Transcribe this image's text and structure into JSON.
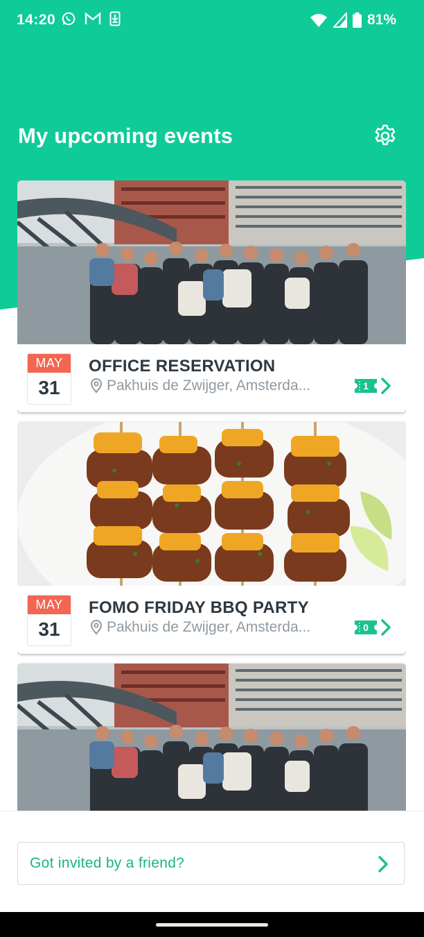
{
  "status_bar": {
    "time": "14:20",
    "battery_percent": "81%",
    "left_icons": [
      "whatsapp-icon",
      "gmail-icon",
      "download-icon"
    ],
    "right_icons": [
      "wifi-icon",
      "signal-icon",
      "battery-icon"
    ]
  },
  "header": {
    "title": "My upcoming events",
    "settings_icon": "gear-icon"
  },
  "events": [
    {
      "month": "MAY",
      "day": "31",
      "title": "OFFICE RESERVATION",
      "location": "Pakhuis de Zwijger, Amsterda...",
      "ticket_count": "1",
      "image": "group-photo"
    },
    {
      "month": "MAY",
      "day": "31",
      "title": "FOMO FRIDAY BBQ PARTY",
      "location": "Pakhuis de Zwijger, Amsterda...",
      "ticket_count": "0",
      "image": "bbq-skewers-photo"
    },
    {
      "image": "group-photo"
    }
  ],
  "invite": {
    "label": "Got invited by a friend?"
  },
  "colors": {
    "brand_green": "#0fcb98",
    "date_red": "#f26652",
    "text_dark": "#2e3840",
    "text_muted": "#9099a0"
  }
}
